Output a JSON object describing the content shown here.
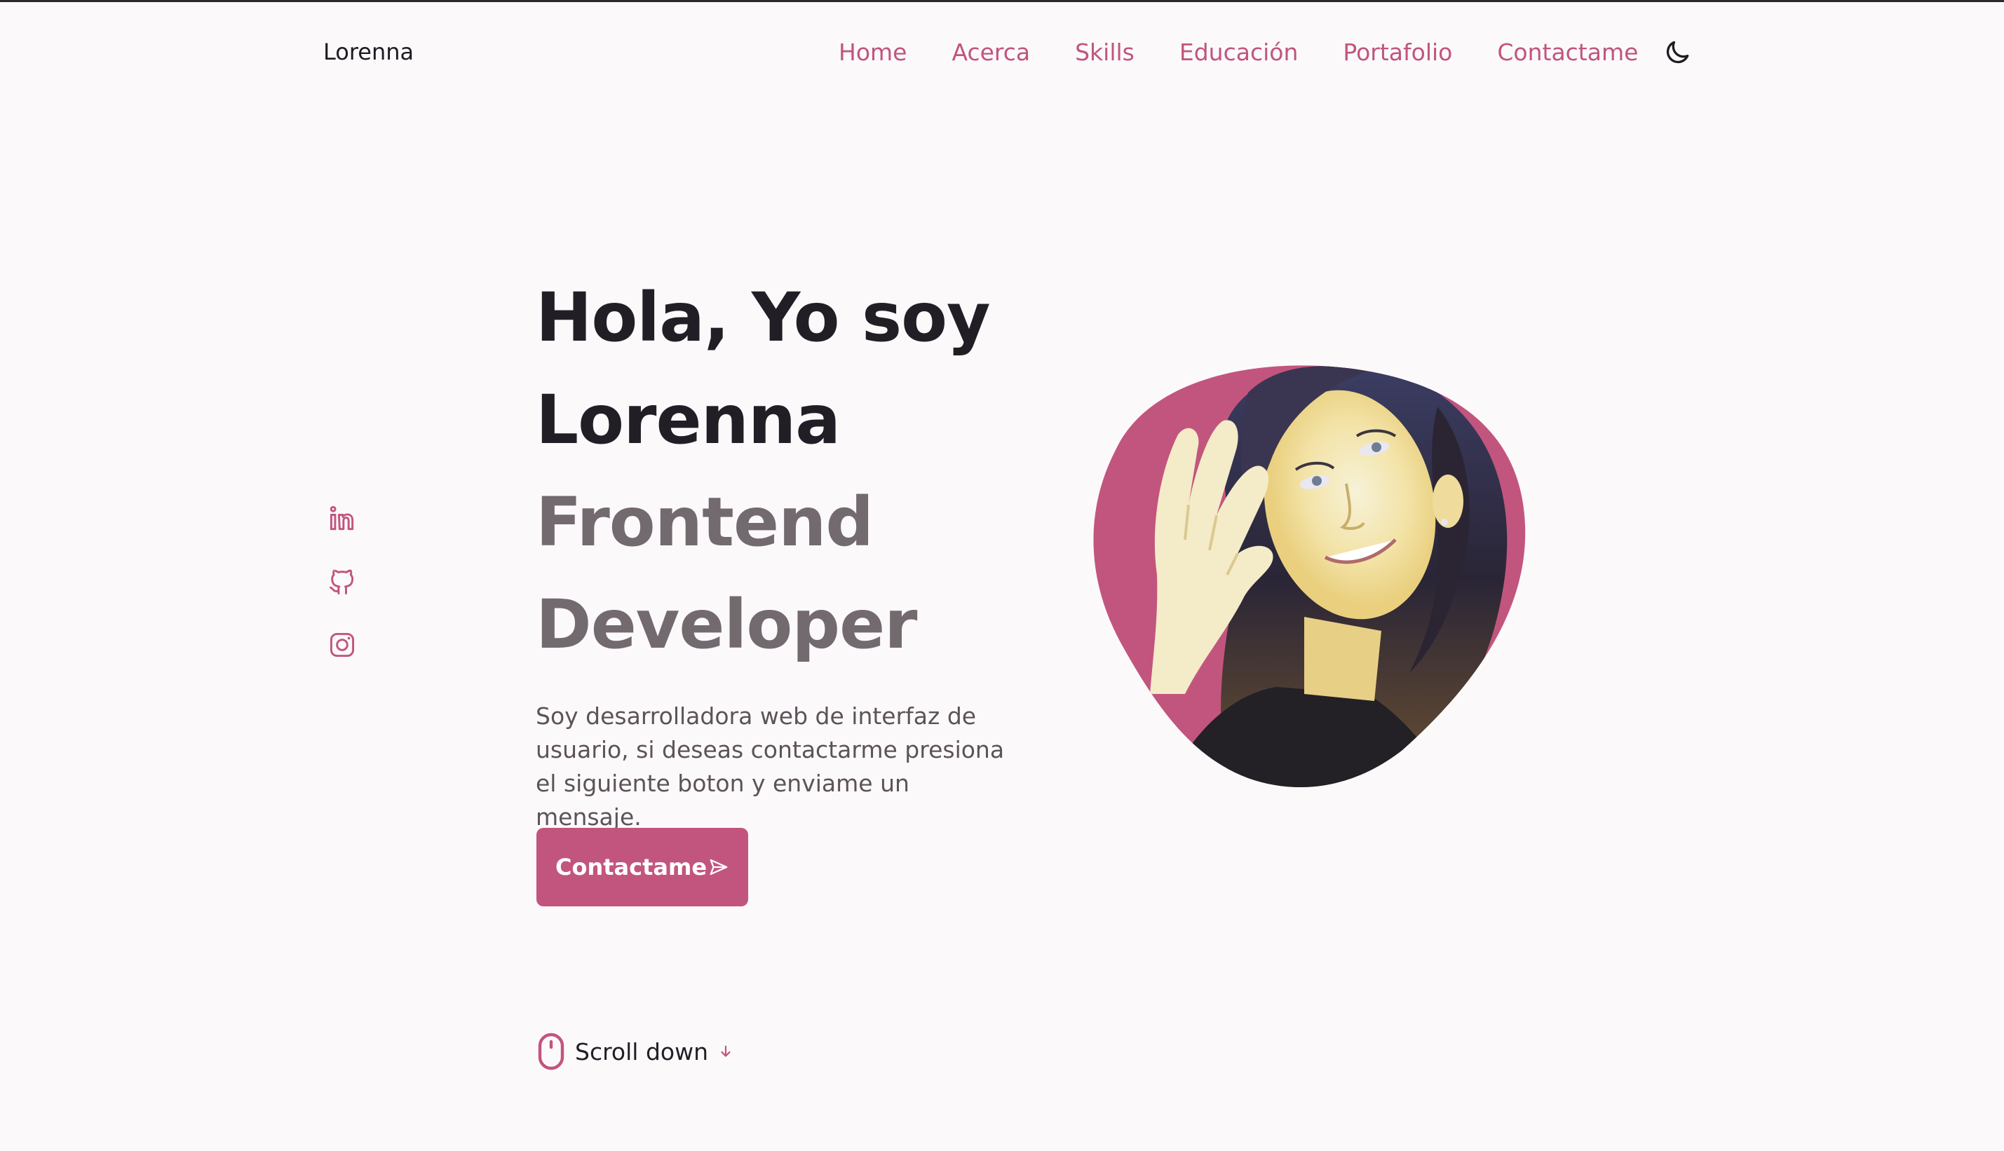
{
  "header": {
    "logo": "Lorenna",
    "nav": [
      "Home",
      "Acerca",
      "Skills",
      "Educación",
      "Portafolio",
      "Contactame"
    ],
    "theme_icon": "moon-icon"
  },
  "social": [
    "linkedin-icon",
    "github-icon",
    "instagram-icon"
  ],
  "hero": {
    "title_line1": "Hola, Yo soy",
    "title_line2": "Lorenna",
    "subtitle_line1": "Frontend",
    "subtitle_line2": "Developer",
    "description": "Soy desarrolladora web de interfaz de usuario, si deseas contactarme presiona el siguiente boton y enviame un mensaje.",
    "cta_label": "Contactame",
    "cta_icon": "send-icon"
  },
  "scroll": {
    "label": "Scroll down",
    "icon": "mouse-icon",
    "arrow_icon": "arrow-down-icon"
  },
  "colors": {
    "accent": "#c2557e",
    "background": "#fcf9fb",
    "title": "#221e26",
    "subtitle": "#736a70",
    "text": "#5c5359"
  }
}
